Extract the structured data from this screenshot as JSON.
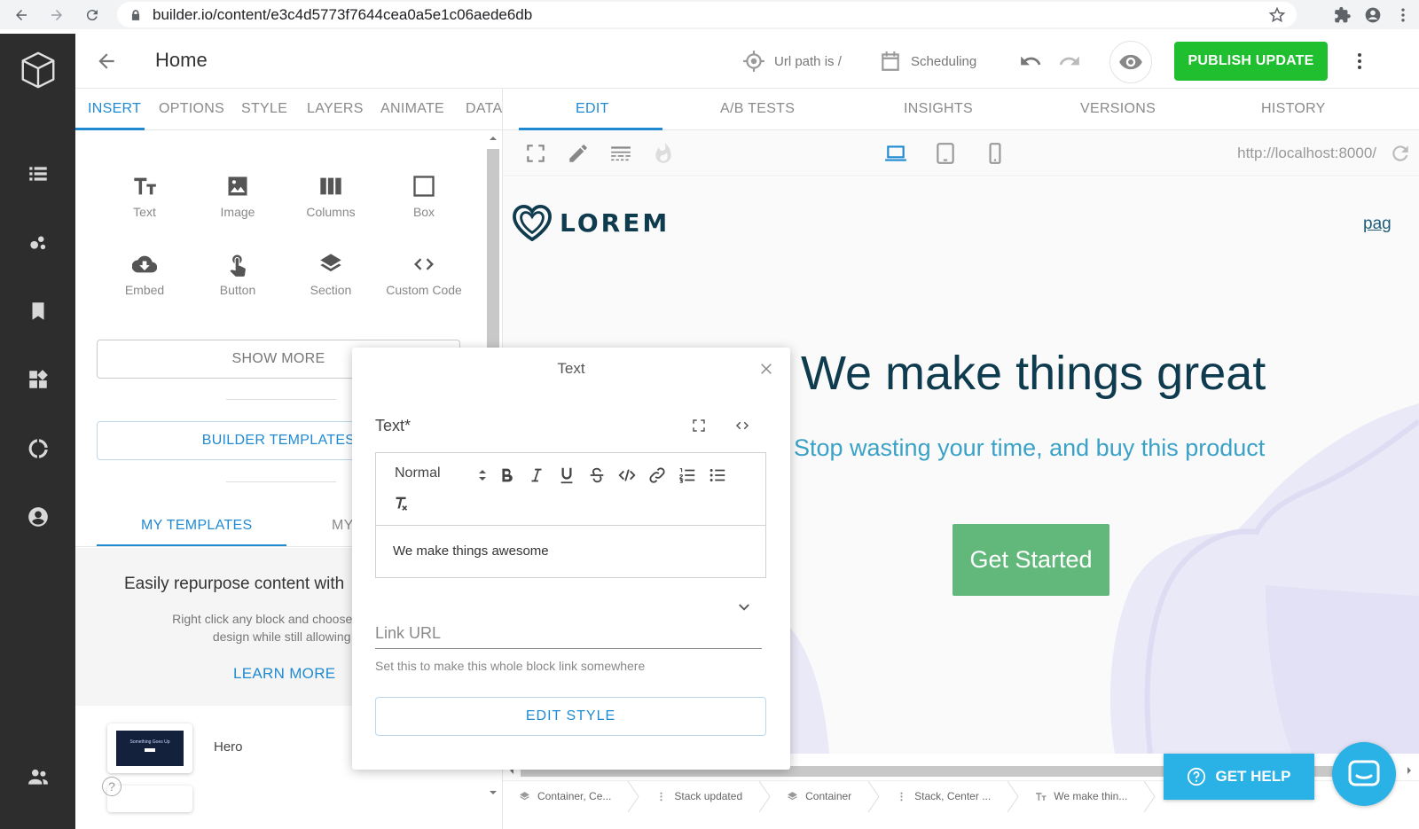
{
  "browser": {
    "url": "builder.io/content/e3c4d5773f7644cea0a5e1c06aede6db"
  },
  "header": {
    "title": "Home",
    "url_path": "Url path is /",
    "scheduling": "Scheduling",
    "publish_label": "PUBLISH UPDATE"
  },
  "left_panel": {
    "tabs": [
      "INSERT",
      "OPTIONS",
      "STYLE",
      "LAYERS",
      "ANIMATE",
      "DATA"
    ],
    "blocks": [
      {
        "label": "Text",
        "icon": "text-icon"
      },
      {
        "label": "Image",
        "icon": "image-icon"
      },
      {
        "label": "Columns",
        "icon": "columns-icon"
      },
      {
        "label": "Box",
        "icon": "box-icon"
      },
      {
        "label": "Embed",
        "icon": "cloud-download-icon"
      },
      {
        "label": "Button",
        "icon": "touch-icon"
      },
      {
        "label": "Section",
        "icon": "layers-icon"
      },
      {
        "label": "Custom Code",
        "icon": "code-icon"
      }
    ],
    "show_more": "SHOW MORE",
    "builder_templates": "BUILDER TEMPLATES",
    "template_tabs": [
      "MY TEMPLATES",
      "MY"
    ],
    "templates_headline": "Easily repurpose content with",
    "templates_desc_line1": "Right click any block and choose 'save as t",
    "templates_desc_line2": "design while still allowing ec",
    "learn_more": "LEARN MORE",
    "template_items": [
      {
        "name": "Hero",
        "thumb_text": "Something Goes Up"
      }
    ]
  },
  "editor": {
    "tabs": [
      "EDIT",
      "A/B TESTS",
      "INSIGHTS",
      "VERSIONS",
      "HISTORY"
    ],
    "preview_url": "http://localhost:8000/"
  },
  "canvas": {
    "logo_text": "LOREM",
    "nav_link": "pag",
    "hero_title": "We make things great",
    "hero_subtitle": "Stop wasting your time, and buy this product",
    "cta_label": "Get Started"
  },
  "dialog": {
    "title": "Text",
    "field_label": "Text*",
    "format_select": "Normal",
    "text_value": "We make things awesome",
    "link_label": "Link URL",
    "link_help": "Set this to make this whole block link somewhere",
    "edit_style": "EDIT STYLE"
  },
  "breadcrumbs": [
    {
      "label": "Container, Ce...",
      "icon": "layers-icon"
    },
    {
      "label": "Stack updated",
      "icon": "vertical-dots-icon"
    },
    {
      "label": "Container",
      "icon": "layers-icon"
    },
    {
      "label": "Stack, Center ...",
      "icon": "vertical-dots-icon"
    },
    {
      "label": "We make thin...",
      "icon": "text-icon"
    }
  ],
  "help": {
    "get_help": "GET HELP",
    "help_mark": "?"
  },
  "colors": {
    "accent": "#1f8ad2",
    "publish": "#1fbf2f",
    "sidebar": "#2d2d2d",
    "hero_title": "#0f3b4f",
    "hero_subtitle": "#3aa1c7",
    "cta": "#62b87b",
    "help": "#2ab1e6"
  }
}
